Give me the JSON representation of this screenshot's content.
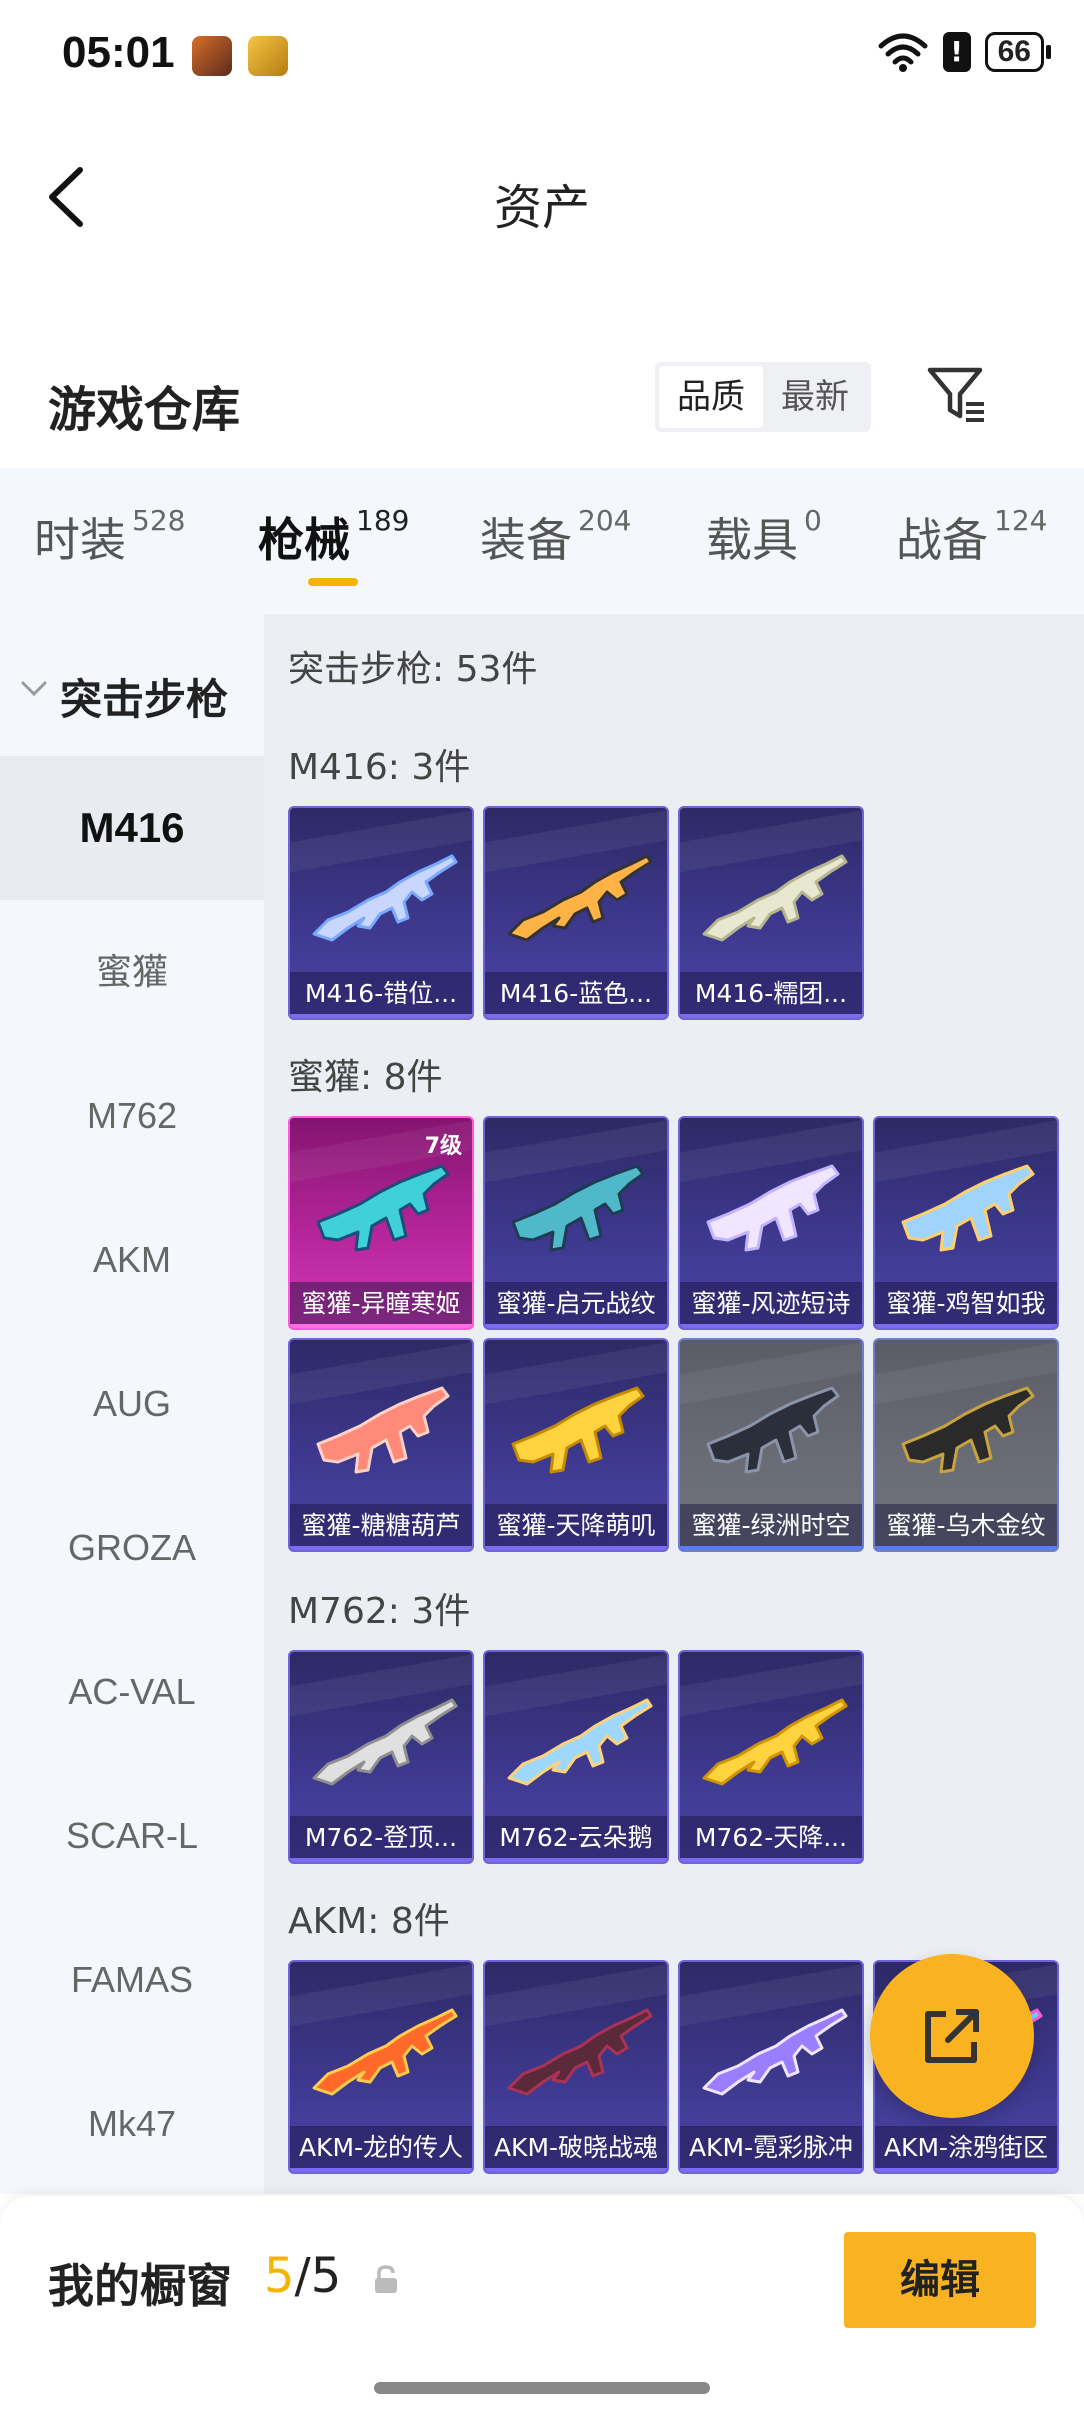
{
  "status_bar": {
    "time": "05:01",
    "battery": "66"
  },
  "nav": {
    "title": "资产"
  },
  "warehouse": {
    "title": "游戏仓库",
    "sort_options": [
      "品质",
      "最新"
    ],
    "active_sort": "品质"
  },
  "tabs": [
    {
      "label": "时装",
      "count": "528"
    },
    {
      "label": "枪械",
      "count": "189"
    },
    {
      "label": "装备",
      "count": "204"
    },
    {
      "label": "载具",
      "count": "0"
    },
    {
      "label": "战备",
      "count": "124"
    }
  ],
  "active_tab": "枪械",
  "sidebar": {
    "group_label": "突击步枪",
    "items": [
      "M416",
      "蜜獾",
      "M762",
      "AKM",
      "AUG",
      "GROZA",
      "AC-VAL",
      "SCAR-L",
      "FAMAS",
      "Mk47"
    ],
    "active_item": "M416"
  },
  "content": {
    "category_title": "突击步枪: 53件",
    "sections": [
      {
        "title": "M416: 3件",
        "items": [
          {
            "name": "M416-错位...",
            "style": "purple"
          },
          {
            "name": "M416-蓝色...",
            "style": "purple"
          },
          {
            "name": "M416-糯团...",
            "style": "purple"
          }
        ]
      },
      {
        "title": "蜜獾: 8件",
        "items": [
          {
            "name": "蜜獾-异瞳寒姬",
            "style": "pink",
            "level": "7级"
          },
          {
            "name": "蜜獾-启元战纹",
            "style": "purple"
          },
          {
            "name": "蜜獾-风迹短诗",
            "style": "purple"
          },
          {
            "name": "蜜獾-鸡智如我",
            "style": "purple"
          },
          {
            "name": "蜜獾-糖糖葫芦",
            "style": "purple"
          },
          {
            "name": "蜜獾-天降萌叽",
            "style": "purple"
          },
          {
            "name": "蜜獾-绿洲时空",
            "style": "grey"
          },
          {
            "name": "蜜獾-乌木金纹",
            "style": "grey"
          }
        ]
      },
      {
        "title": "M762: 3件",
        "items": [
          {
            "name": "M762-登顶...",
            "style": "purple"
          },
          {
            "name": "M762-云朵鹅",
            "style": "purple"
          },
          {
            "name": "M762-天降...",
            "style": "purple"
          }
        ]
      },
      {
        "title": "AKM: 8件",
        "items": [
          {
            "name": "AKM-龙的传人",
            "style": "purple"
          },
          {
            "name": "AKM-破晓战魂",
            "style": "purple"
          },
          {
            "name": "AKM-霓彩脉冲",
            "style": "purple"
          },
          {
            "name": "AKM-涂鸦街区",
            "style": "purple"
          }
        ]
      }
    ]
  },
  "bottom": {
    "showcase_label": "我的橱窗",
    "showcase_current": "5",
    "showcase_sep": "/",
    "showcase_max": "5",
    "edit_label": "编辑"
  },
  "colors": {
    "accent": "#f5b400",
    "card_purple": "#3d388d",
    "card_pink": "#b9279e",
    "card_grey": "#6a6d76"
  }
}
